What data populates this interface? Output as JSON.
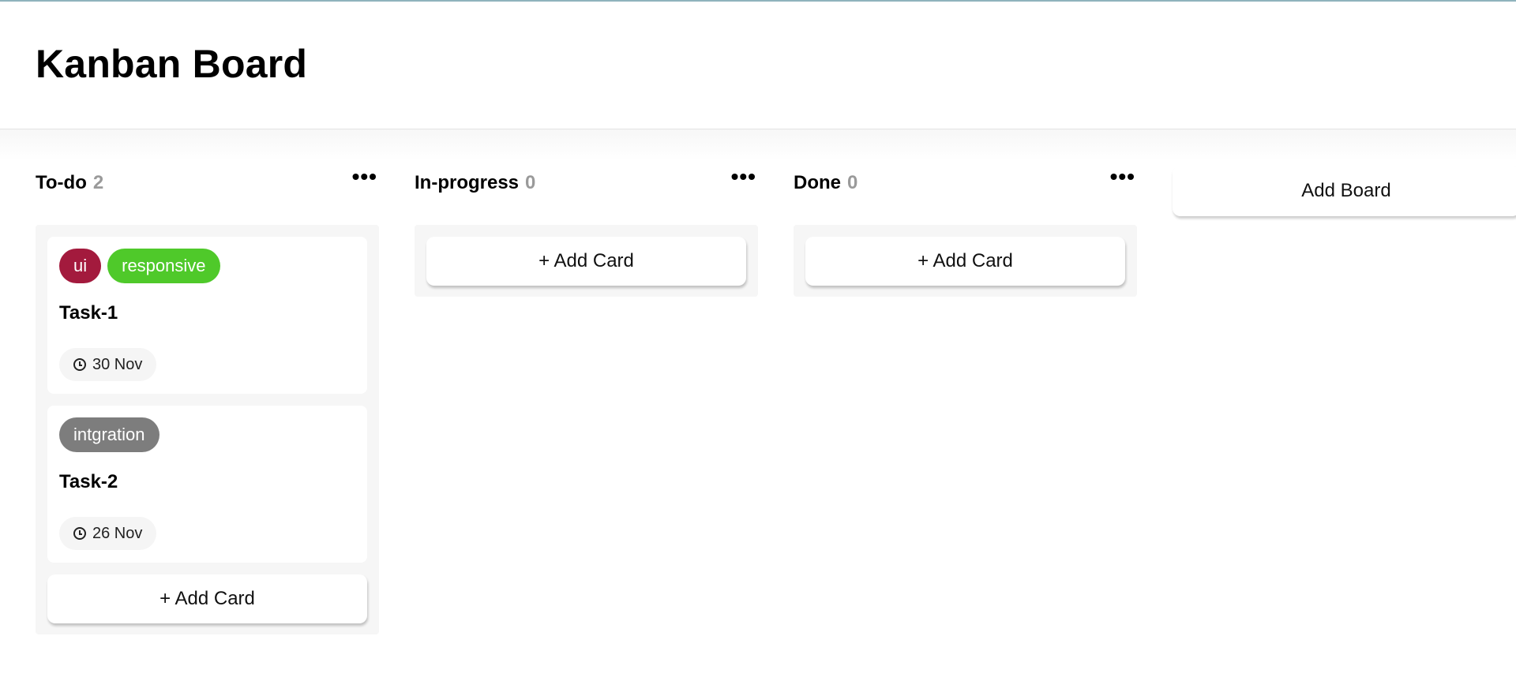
{
  "header": {
    "title": "Kanban Board"
  },
  "colors": {
    "ui": "#a31a3d",
    "responsive": "#4fc92a",
    "intgration": "#7d7d7d",
    "count": "#9a9a9a"
  },
  "boards": [
    {
      "title": "To-do",
      "count": "2",
      "menu": "•••",
      "cards": [
        {
          "labels": [
            {
              "text": "ui",
              "color": "#a31a3d"
            },
            {
              "text": "responsive",
              "color": "#4fc92a"
            }
          ],
          "title": "Task-1",
          "date": "30 Nov"
        },
        {
          "labels": [
            {
              "text": "intgration",
              "color": "#7d7d7d"
            }
          ],
          "title": "Task-2",
          "date": "26 Nov"
        }
      ],
      "add_card_label": "+ Add Card"
    },
    {
      "title": "In-progress",
      "count": "0",
      "menu": "•••",
      "cards": [],
      "add_card_label": "+ Add Card"
    },
    {
      "title": "Done",
      "count": "0",
      "menu": "•••",
      "cards": [],
      "add_card_label": "+ Add Card"
    }
  ],
  "add_board_label": "Add Board"
}
